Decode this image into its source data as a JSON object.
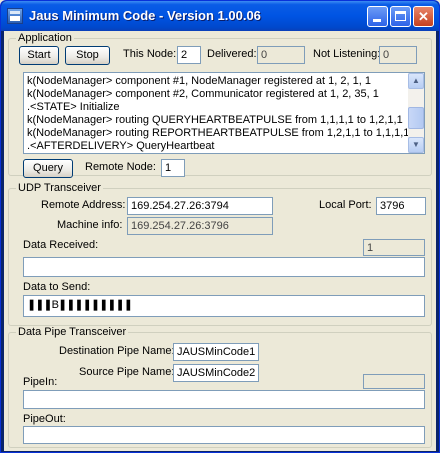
{
  "window": {
    "title": "Jaus Minimum Code - Version 1.00.06"
  },
  "application": {
    "group_label": "Application",
    "start_label": "Start",
    "stop_label": "Stop",
    "this_node_label": "This Node:",
    "this_node_value": "2",
    "delivered_label": "Delivered:",
    "delivered_value": "0",
    "not_listening_label": "Not Listening:",
    "not_listening_value": "0",
    "log_lines": [
      "k(NodeManager> component #1, NodeManager registered at 1, 2, 1, 1",
      "k(NodeManager> component #2, Communicator registered at 1, 2, 35, 1",
      ".<STATE> Initialize",
      "k(NodeManager> routing QUERYHEARTBEATPULSE from 1,1,1,1 to 1,2,1,1",
      "k(NodeManager> routing REPORTHEARTBEATPULSE from 1,2,1,1 to 1,1,1,1",
      ".<AFTERDELIVERY> QueryHeartbeat"
    ],
    "query_label": "Query",
    "remote_node_label": "Remote Node:",
    "remote_node_value": "1"
  },
  "udp": {
    "group_label": "UDP Transceiver",
    "remote_address_label": "Remote Address:",
    "remote_address_value": "169.254.27.26:3794",
    "local_port_label": "Local Port:",
    "local_port_value": "3796",
    "machine_info_label": "Machine info:",
    "machine_info_value": "169.254.27.26:3796",
    "data_received_label": "Data Received:",
    "data_received_count": "1",
    "data_received_value": "",
    "data_to_send_label": "Data to Send:",
    "data_to_send_value": "❚❚❚B❚❚❚❚❚❚❚❚❚"
  },
  "pipe": {
    "group_label": "Data Pipe Transceiver",
    "dest_pipe_label": "Destination Pipe Name:",
    "dest_pipe_value": "JAUSMinCode1",
    "source_pipe_label": "Source Pipe Name:",
    "source_pipe_value": "JAUSMinCode2",
    "pipe_in_label": "PipeIn:",
    "pipe_in_count": "",
    "pipe_in_value": "",
    "pipe_out_label": "PipeOut:",
    "pipe_out_value": ""
  }
}
